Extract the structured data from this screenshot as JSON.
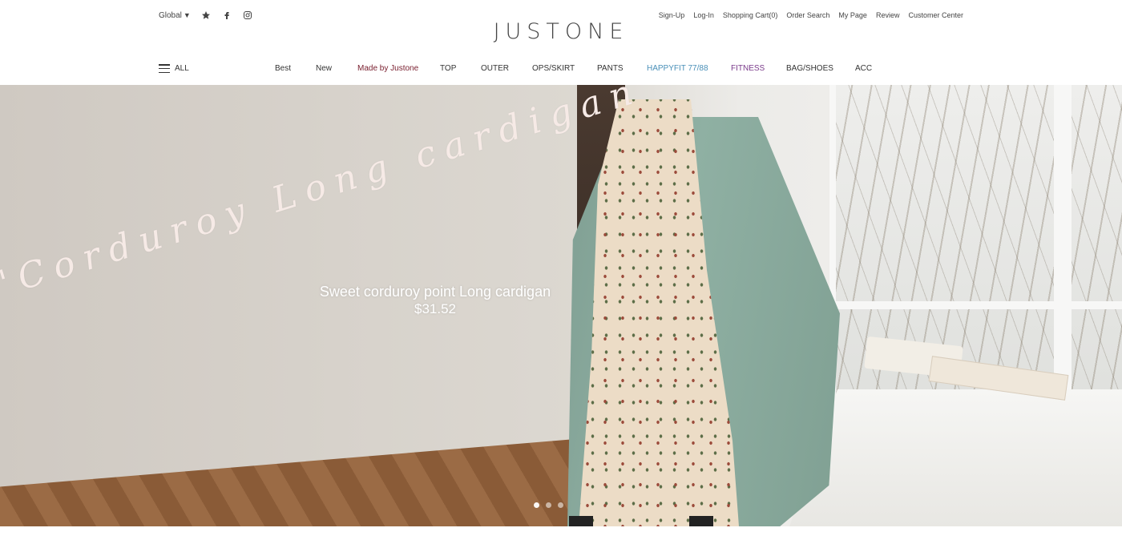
{
  "header": {
    "global_label": "Global",
    "logo": "JUSTONE",
    "util_links": [
      "Sign-Up",
      "Log-In",
      "Shopping Cart(0)",
      "Order Search",
      "My Page",
      "Review",
      "Customer Center"
    ],
    "all_label": "ALL",
    "social_icons": [
      "star-icon",
      "facebook-icon",
      "instagram-icon"
    ]
  },
  "nav": {
    "items": [
      {
        "label": "Best",
        "color": "#333333"
      },
      {
        "label": "New",
        "color": "#333333"
      },
      {
        "label": "Made by Justone",
        "color": "#7a2030"
      },
      {
        "label": "TOP",
        "color": "#333333"
      },
      {
        "label": "OUTER",
        "color": "#333333"
      },
      {
        "label": "OPS/SKIRT",
        "color": "#333333"
      },
      {
        "label": "PANTS",
        "color": "#333333"
      },
      {
        "label": "HAPPYFIT 77/88",
        "color": "#4a90b8"
      },
      {
        "label": "FITNESS",
        "color": "#7a3a8a"
      },
      {
        "label": "BAG/SHOES",
        "color": "#333333"
      },
      {
        "label": "ACC",
        "color": "#333333"
      }
    ]
  },
  "hero": {
    "script_text": "\"Corduroy Long cardigan\"",
    "title": "Sweet corduroy point Long cardigan",
    "price": "$31.52",
    "slides": 3,
    "active_slide": 1
  }
}
